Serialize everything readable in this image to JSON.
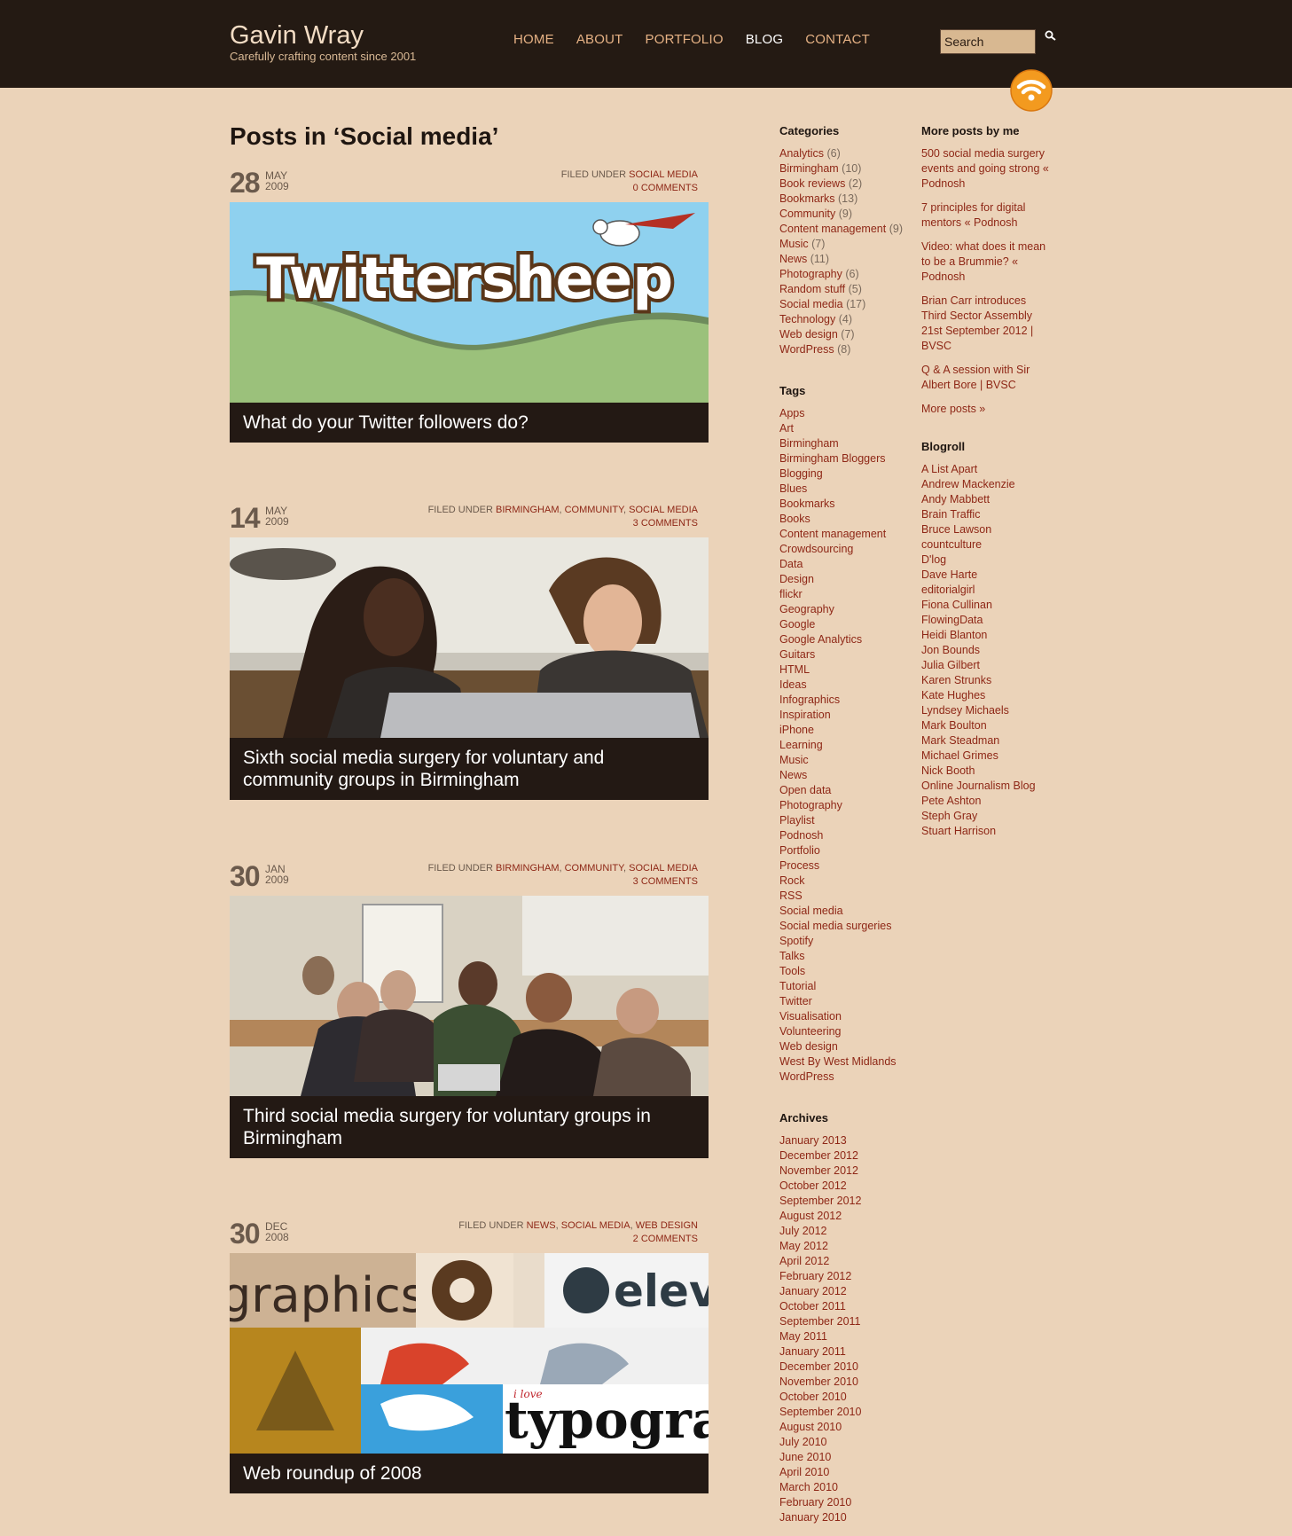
{
  "site": {
    "title": "Gavin Wray",
    "tagline": "Carefully crafting content since 2001"
  },
  "nav": {
    "items": [
      {
        "label": "HOME"
      },
      {
        "label": "ABOUT"
      },
      {
        "label": "PORTFOLIO"
      },
      {
        "label": "BLOG",
        "active": true
      },
      {
        "label": "CONTACT"
      }
    ]
  },
  "search": {
    "value": "Search"
  },
  "page_title": "Posts in ‘Social media’",
  "filed_under_label": "FILED UNDER",
  "posts": [
    {
      "day": "28",
      "month": "MAY",
      "year": "2009",
      "categories": [
        "SOCIAL MEDIA"
      ],
      "comments": "0 COMMENTS",
      "title": "What do your Twitter followers do?",
      "image_text": "Twittersheep"
    },
    {
      "day": "14",
      "month": "MAY",
      "year": "2009",
      "categories": [
        "BIRMINGHAM",
        "COMMUNITY",
        "SOCIAL MEDIA"
      ],
      "comments": "3 COMMENTS",
      "title": "Sixth social media surgery for voluntary and community groups in Birmingham"
    },
    {
      "day": "30",
      "month": "JAN",
      "year": "2009",
      "categories": [
        "BIRMINGHAM",
        "COMMUNITY",
        "SOCIAL MEDIA"
      ],
      "comments": "3 COMMENTS",
      "title": "Third social media surgery for voluntary groups in Birmingham"
    },
    {
      "day": "30",
      "month": "DEC",
      "year": "2008",
      "categories": [
        "NEWS",
        "SOCIAL MEDIA",
        "WEB DESIGN"
      ],
      "comments": "2 COMMENTS",
      "title": "Web roundup of 2008",
      "image_texts": [
        "graphics",
        "eleve",
        "i love",
        "typogra"
      ]
    }
  ],
  "categories": {
    "title": "Categories",
    "items": [
      {
        "name": "Analytics",
        "count": "(6)"
      },
      {
        "name": "Birmingham",
        "count": "(10)"
      },
      {
        "name": "Book reviews",
        "count": "(2)"
      },
      {
        "name": "Bookmarks",
        "count": "(13)"
      },
      {
        "name": "Community",
        "count": "(9)"
      },
      {
        "name": "Content management",
        "count": "(9)"
      },
      {
        "name": "Music",
        "count": "(7)"
      },
      {
        "name": "News",
        "count": "(11)"
      },
      {
        "name": "Photography",
        "count": "(6)"
      },
      {
        "name": "Random stuff",
        "count": "(5)"
      },
      {
        "name": "Social media",
        "count": "(17)"
      },
      {
        "name": "Technology",
        "count": "(4)"
      },
      {
        "name": "Web design",
        "count": "(7)"
      },
      {
        "name": "WordPress",
        "count": "(8)"
      }
    ]
  },
  "tags": {
    "title": "Tags",
    "items": [
      "Apps",
      "Art",
      "Birmingham",
      "Birmingham Bloggers",
      "Blogging",
      "Blues",
      "Bookmarks",
      "Books",
      "Content management",
      "Crowdsourcing",
      "Data",
      "Design",
      "flickr",
      "Geography",
      "Google",
      "Google Analytics",
      "Guitars",
      "HTML",
      "Ideas",
      "Infographics",
      "Inspiration",
      "iPhone",
      "Learning",
      "Music",
      "News",
      "Open data",
      "Photography",
      "Playlist",
      "Podnosh",
      "Portfolio",
      "Process",
      "Rock",
      "RSS",
      "Social media",
      "Social media surgeries",
      "Spotify",
      "Talks",
      "Tools",
      "Tutorial",
      "Twitter",
      "Visualisation",
      "Volunteering",
      "Web design",
      "West By West Midlands",
      "WordPress"
    ]
  },
  "archives": {
    "title": "Archives",
    "items": [
      "January 2013",
      "December 2012",
      "November 2012",
      "October 2012",
      "September 2012",
      "August 2012",
      "July 2012",
      "May 2012",
      "April 2012",
      "February 2012",
      "January 2012",
      "October 2011",
      "September 2011",
      "May 2011",
      "January 2011",
      "December 2010",
      "November 2010",
      "October 2010",
      "September 2010",
      "August 2010",
      "July 2010",
      "June 2010",
      "April 2010",
      "March 2010",
      "February 2010",
      "January 2010"
    ]
  },
  "more_posts": {
    "title": "More posts by me",
    "items": [
      "500 social media surgery events and going strong « Podnosh",
      "7 principles for digital mentors « Podnosh",
      "Video: what does it mean to be a Brummie? « Podnosh",
      "Brian Carr introduces Third Sector Assembly 21st September 2012 | BVSC",
      "Q & A session with Sir Albert Bore | BVSC",
      "More posts »"
    ]
  },
  "blogroll": {
    "title": "Blogroll",
    "items": [
      "A List Apart",
      "Andrew Mackenzie",
      "Andy Mabbett",
      "Brain Traffic",
      "Bruce Lawson",
      "countculture",
      "D'log",
      "Dave Harte",
      "editorialgirl",
      "Fiona Cullinan",
      "FlowingData",
      "Heidi Blanton",
      "Jon Bounds",
      "Julia Gilbert",
      "Karen Strunks",
      "Kate Hughes",
      "Lyndsey Michaels",
      "Mark Boulton",
      "Mark Steadman",
      "Michael Grimes",
      "Nick Booth",
      "Online Journalism Blog",
      "Pete Ashton",
      "Steph Gray",
      "Stuart Harrison"
    ]
  },
  "colors": {
    "header_bg": "#241a13",
    "page_bg": "#ebd3b9",
    "link": "#8e2716",
    "nav": "#e5b184",
    "caption_bg": "#231914"
  }
}
